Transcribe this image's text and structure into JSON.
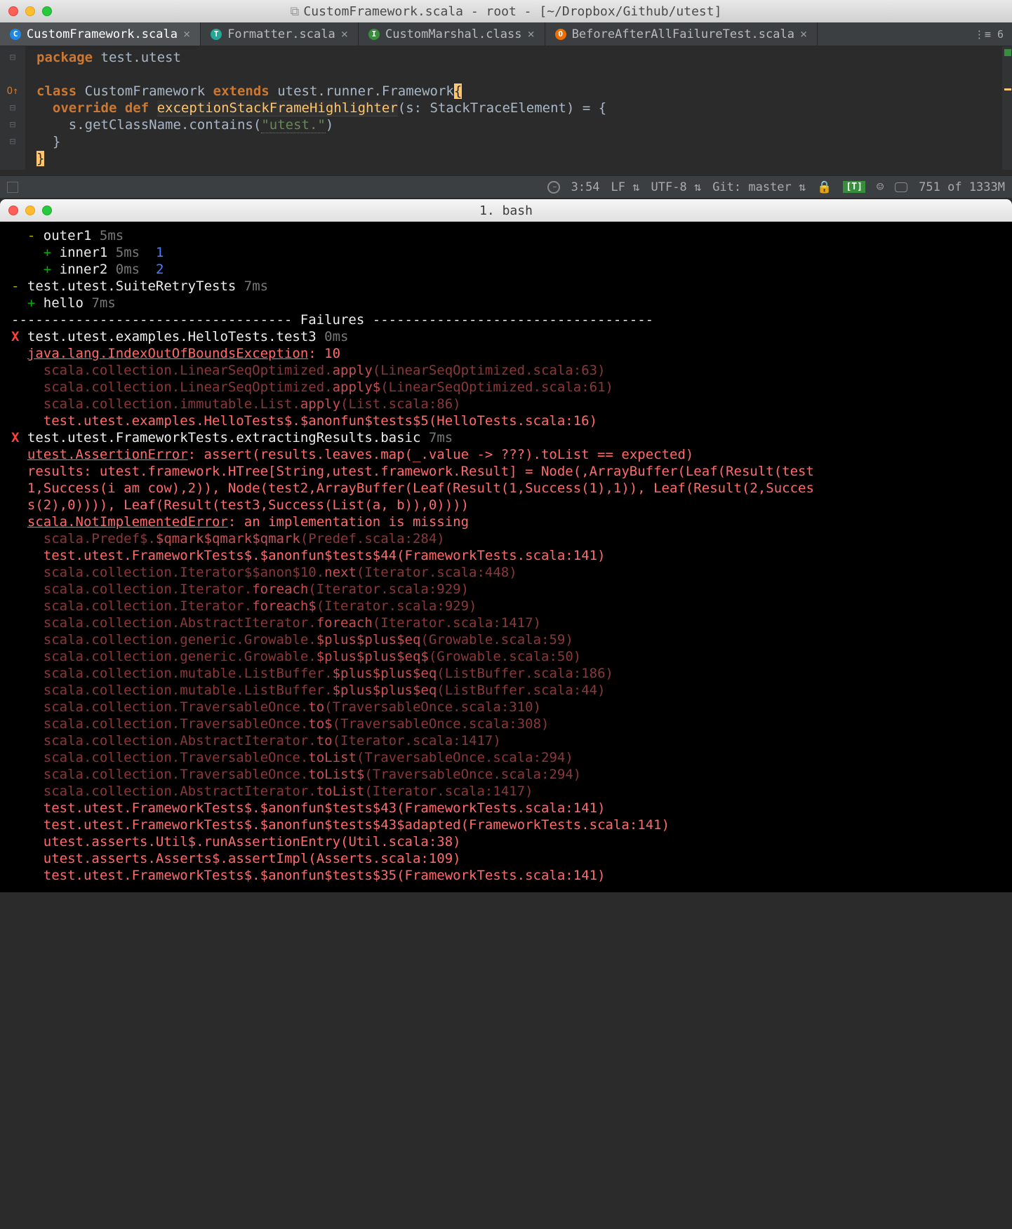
{
  "ide": {
    "window_title": "CustomFramework.scala - root - [~/Dropbox/Github/utest]",
    "tabs": [
      {
        "label": "CustomFramework.scala",
        "icon": "C",
        "icon_class": "c",
        "active": true
      },
      {
        "label": "Formatter.scala",
        "icon": "T",
        "icon_class": "t",
        "active": false
      },
      {
        "label": "CustomMarshal.class",
        "icon": "I",
        "icon_class": "i",
        "active": false
      },
      {
        "label": "BeforeAfterAllFailureTest.scala",
        "icon": "O",
        "icon_class": "o",
        "active": false
      }
    ],
    "tab_overflow": "⋮≡ 6",
    "code": {
      "l1_pkg": "package",
      "l1_pkgname": " test.utest",
      "l3_class": "class",
      "l3_classname": " CustomFramework ",
      "l3_extends": "extends",
      "l3_super": " utest.runner.Framework",
      "l3_brace": "{",
      "l4_override": "override",
      "l4_def": " def ",
      "l4_fn": "exceptionStackFrameHighlighter",
      "l4_params": "(s: StackTraceElement) = {",
      "l5_body": "s.getClassName.contains(",
      "l5_str": "\"utest.\"",
      "l5_close": ")",
      "l6_brace": "}",
      "l7_brace": "}"
    },
    "statusbar": {
      "cursor": "3:54",
      "line_end": "LF",
      "encoding": "UTF-8",
      "git": "Git: master",
      "mem": "751 of 1333M",
      "t_badge": "[T]"
    }
  },
  "terminal": {
    "title": "1. bash",
    "lines_top": [
      {
        "prefix": "-",
        "prefix_class": "t-minus",
        "indent": "  ",
        "name": "outer1",
        "time": "5ms",
        "val": ""
      },
      {
        "prefix": "+",
        "prefix_class": "t-plus",
        "indent": "    ",
        "name": "inner1",
        "time": "5ms",
        "val": "1"
      },
      {
        "prefix": "+",
        "prefix_class": "t-plus",
        "indent": "    ",
        "name": "inner2",
        "time": "0ms",
        "val": "2"
      },
      {
        "prefix": "-",
        "prefix_class": "t-minus",
        "indent": "",
        "name": "test.utest.SuiteRetryTests",
        "time": "7ms",
        "val": ""
      },
      {
        "prefix": "+",
        "prefix_class": "t-plus",
        "indent": "  ",
        "name": "hello",
        "time": "7ms",
        "val": ""
      }
    ],
    "failures_divider": "----------------------------------- Failures -----------------------------------",
    "failure1": {
      "x": "X",
      "header_name": "test.utest.examples.HelloTests.test3",
      "header_time": "0ms",
      "exc": "java.lang.IndexOutOfBoundsException",
      "exc_msg": ": 10",
      "stack": [
        {
          "pkg": "scala.collection.LinearSeqOptimized.",
          "m": "apply",
          "loc": "(LinearSeqOptimized.scala:63)",
          "dim": true
        },
        {
          "pkg": "scala.collection.LinearSeqOptimized.",
          "m": "apply$",
          "loc": "(LinearSeqOptimized.scala:61)",
          "dim": true
        },
        {
          "pkg": "scala.collection.immutable.List.",
          "m": "apply",
          "loc": "(List.scala:86)",
          "dim": true
        },
        {
          "pkg": "test.utest.examples.HelloTests$.",
          "m": "$anonfun$tests$5",
          "loc": "(HelloTests.scala:16)",
          "dim": false
        }
      ]
    },
    "failure2": {
      "x": "X",
      "header_name": "test.utest.FrameworkTests.extractingResults.basic",
      "header_time": "7ms",
      "exc1": "utest.AssertionError",
      "exc1_msg": ": assert(results.leaves.map(_.value -> ???).toList == expected)",
      "results_lines": [
        "results: utest.framework.HTree[String,utest.framework.Result] = Node(,ArrayBuffer(Leaf(Result(test",
        "1,Success(i am cow),2)), Node(test2,ArrayBuffer(Leaf(Result(1,Success(1),1)), Leaf(Result(2,Succes",
        "s(2),0)))), Leaf(Result(test3,Success(List(a, b)),0))))"
      ],
      "exc2": "scala.NotImplementedError",
      "exc2_msg": ": an implementation is missing",
      "stack": [
        {
          "pkg": "scala.Predef$.",
          "m": "$qmark$qmark$qmark",
          "loc": "(Predef.scala:284)",
          "dim": true
        },
        {
          "pkg": "test.utest.FrameworkTests$.",
          "m": "$anonfun$tests$44",
          "loc": "(FrameworkTests.scala:141)",
          "dim": false
        },
        {
          "pkg": "scala.collection.Iterator$$anon$10.",
          "m": "next",
          "loc": "(Iterator.scala:448)",
          "dim": true
        },
        {
          "pkg": "scala.collection.Iterator.",
          "m": "foreach",
          "loc": "(Iterator.scala:929)",
          "dim": true
        },
        {
          "pkg": "scala.collection.Iterator.",
          "m": "foreach$",
          "loc": "(Iterator.scala:929)",
          "dim": true
        },
        {
          "pkg": "scala.collection.AbstractIterator.",
          "m": "foreach",
          "loc": "(Iterator.scala:1417)",
          "dim": true
        },
        {
          "pkg": "scala.collection.generic.Growable.",
          "m": "$plus$plus$eq",
          "loc": "(Growable.scala:59)",
          "dim": true
        },
        {
          "pkg": "scala.collection.generic.Growable.",
          "m": "$plus$plus$eq$",
          "loc": "(Growable.scala:50)",
          "dim": true
        },
        {
          "pkg": "scala.collection.mutable.ListBuffer.",
          "m": "$plus$plus$eq",
          "loc": "(ListBuffer.scala:186)",
          "dim": true
        },
        {
          "pkg": "scala.collection.mutable.ListBuffer.",
          "m": "$plus$plus$eq",
          "loc": "(ListBuffer.scala:44)",
          "dim": true
        },
        {
          "pkg": "scala.collection.TraversableOnce.",
          "m": "to",
          "loc": "(TraversableOnce.scala:310)",
          "dim": true
        },
        {
          "pkg": "scala.collection.TraversableOnce.",
          "m": "to$",
          "loc": "(TraversableOnce.scala:308)",
          "dim": true
        },
        {
          "pkg": "scala.collection.AbstractIterator.",
          "m": "to",
          "loc": "(Iterator.scala:1417)",
          "dim": true
        },
        {
          "pkg": "scala.collection.TraversableOnce.",
          "m": "toList",
          "loc": "(TraversableOnce.scala:294)",
          "dim": true
        },
        {
          "pkg": "scala.collection.TraversableOnce.",
          "m": "toList$",
          "loc": "(TraversableOnce.scala:294)",
          "dim": true
        },
        {
          "pkg": "scala.collection.AbstractIterator.",
          "m": "toList",
          "loc": "(Iterator.scala:1417)",
          "dim": true
        },
        {
          "pkg": "test.utest.FrameworkTests$.",
          "m": "$anonfun$tests$43",
          "loc": "(FrameworkTests.scala:141)",
          "dim": false
        },
        {
          "pkg": "test.utest.FrameworkTests$.",
          "m": "$anonfun$tests$43$adapted",
          "loc": "(FrameworkTests.scala:141)",
          "dim": false
        },
        {
          "pkg": "utest.asserts.Util$.",
          "m": "runAssertionEntry",
          "loc": "(Util.scala:38)",
          "dim": false
        },
        {
          "pkg": "utest.asserts.Asserts$.",
          "m": "assertImpl",
          "loc": "(Asserts.scala:109)",
          "dim": false
        },
        {
          "pkg": "test.utest.FrameworkTests$.",
          "m": "$anonfun$tests$35",
          "loc": "(FrameworkTests.scala:141)",
          "dim": false
        }
      ]
    }
  }
}
